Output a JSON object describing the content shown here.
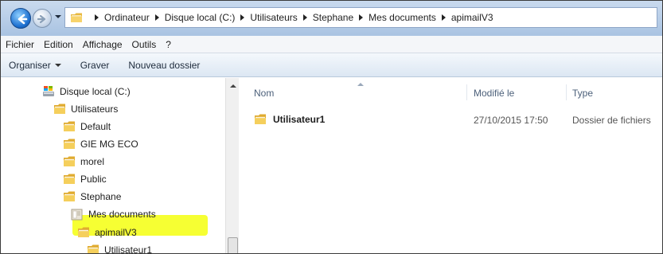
{
  "address": {
    "path": [
      "Ordinateur",
      "Disque local (C:)",
      "Utilisateurs",
      "Stephane",
      "Mes documents",
      "apimailV3"
    ]
  },
  "menu": [
    "Fichier",
    "Edition",
    "Affichage",
    "Outils",
    "?"
  ],
  "toolbar": {
    "organize": "Organiser",
    "burn": "Graver",
    "new_folder": "Nouveau dossier"
  },
  "tree": [
    {
      "label": "Disque local (C:)",
      "icon": "drive-icon"
    },
    {
      "label": "Utilisateurs",
      "icon": "folder-icon"
    },
    {
      "label": "Default",
      "icon": "folder-icon"
    },
    {
      "label": "GIE MG ECO",
      "icon": "folder-icon"
    },
    {
      "label": "morel",
      "icon": "folder-icon"
    },
    {
      "label": "Public",
      "icon": "folder-icon"
    },
    {
      "label": "Stephane",
      "icon": "folder-icon"
    },
    {
      "label": "Mes documents",
      "icon": "document-folder-icon"
    },
    {
      "label": "apimailV3",
      "icon": "folder-icon"
    },
    {
      "label": "Utilisateur1",
      "icon": "folder-icon"
    }
  ],
  "highlight_color": "#f6ff33",
  "columns": {
    "name": "Nom",
    "modified": "Modifié le",
    "type": "Type"
  },
  "files": [
    {
      "name": "Utilisateur1",
      "modified": "27/10/2015 17:50",
      "type": "Dossier de fichiers"
    }
  ]
}
